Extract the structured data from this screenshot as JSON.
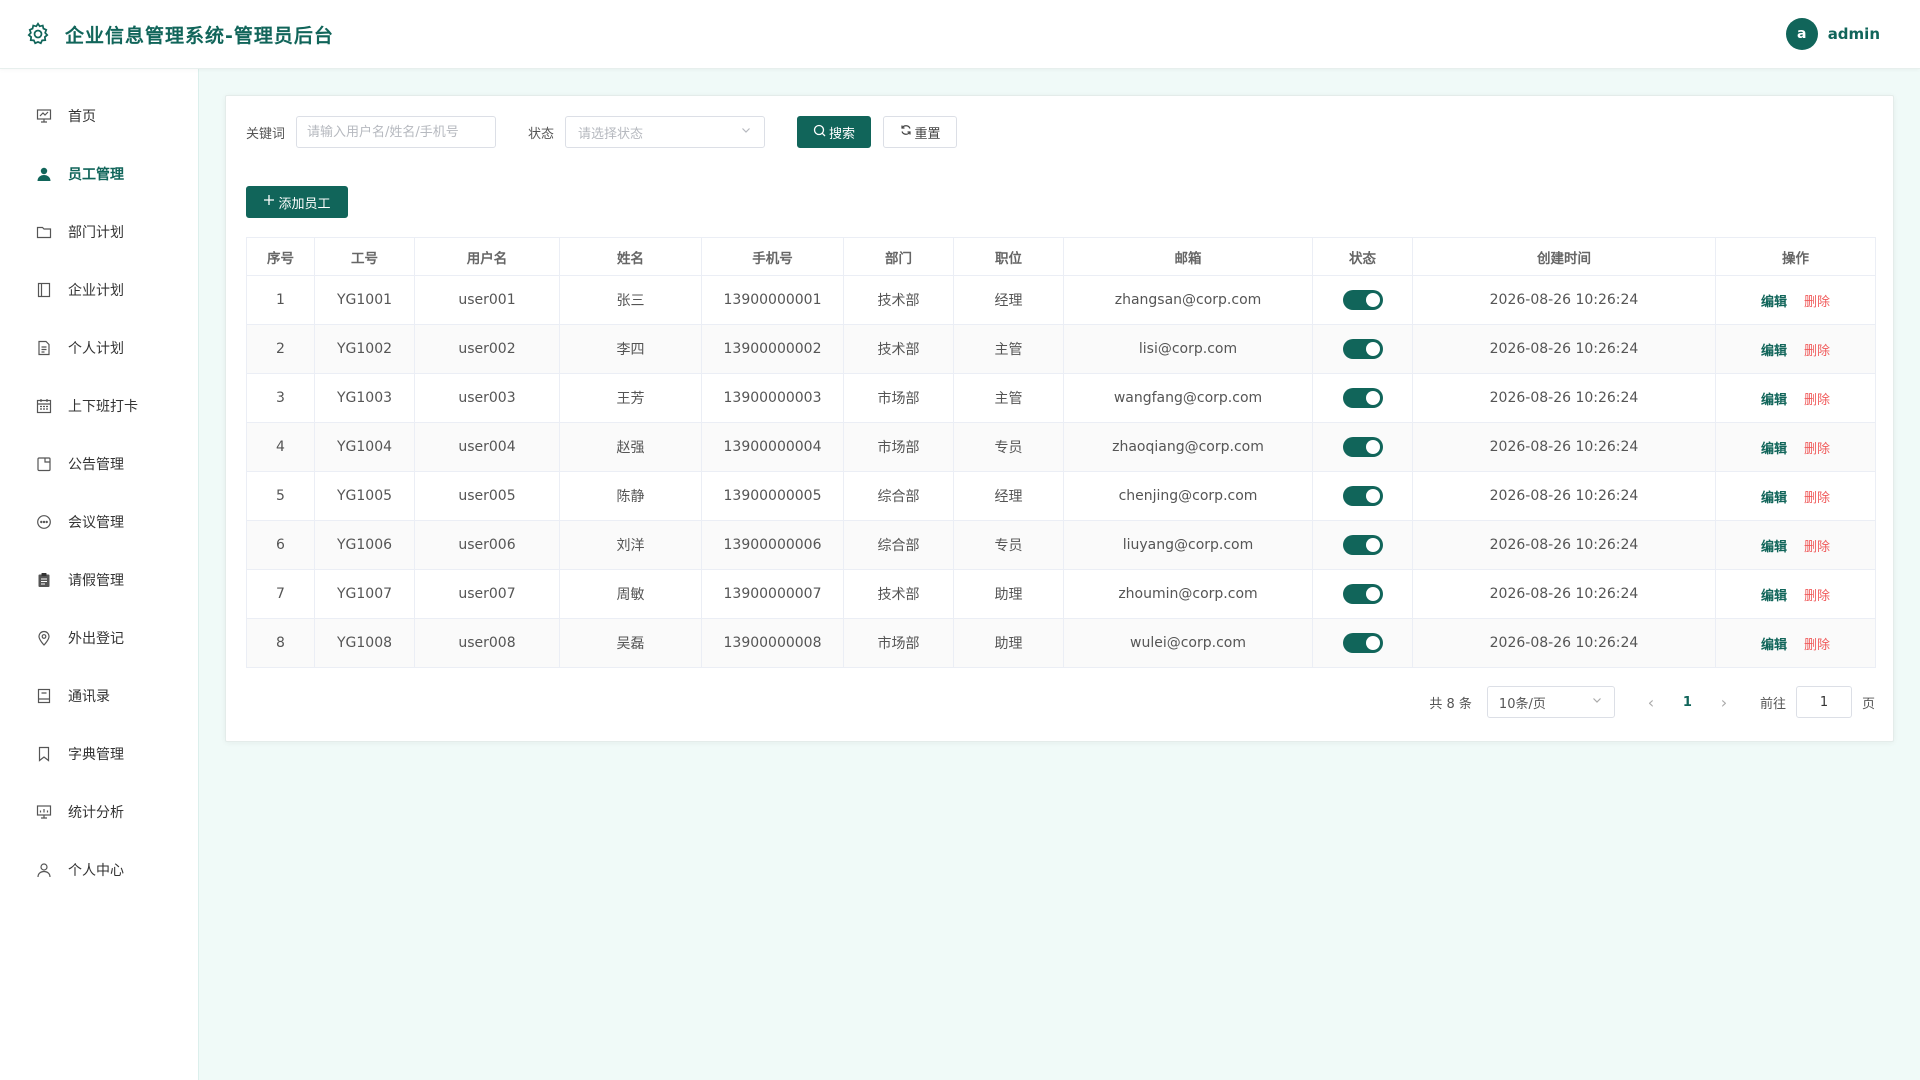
{
  "header": {
    "title": "企业信息管理系统-管理员后台",
    "avatar_letter": "a",
    "username": "admin"
  },
  "colors": {
    "accent": "#11655a",
    "danger": "#f05a5a",
    "background": "#f0faf8"
  },
  "sidebar": {
    "items": [
      {
        "label": "首页",
        "icon": "presentation-chart-icon",
        "active": false
      },
      {
        "label": "员工管理",
        "icon": "user-icon",
        "active": true
      },
      {
        "label": "部门计划",
        "icon": "folder-icon",
        "active": false
      },
      {
        "label": "企业计划",
        "icon": "notebook-icon",
        "active": false
      },
      {
        "label": "个人计划",
        "icon": "document-icon",
        "active": false
      },
      {
        "label": "上下班打卡",
        "icon": "calendar-icon",
        "active": false
      },
      {
        "label": "公告管理",
        "icon": "notice-icon",
        "active": false
      },
      {
        "label": "会议管理",
        "icon": "chat-icon",
        "active": false
      },
      {
        "label": "请假管理",
        "icon": "clipboard-icon",
        "active": false
      },
      {
        "label": "外出登记",
        "icon": "location-icon",
        "active": false
      },
      {
        "label": "通讯录",
        "icon": "contacts-book-icon",
        "active": false
      },
      {
        "label": "字典管理",
        "icon": "bookmark-icon",
        "active": false
      },
      {
        "label": "统计分析",
        "icon": "stats-board-icon",
        "active": false
      },
      {
        "label": "个人中心",
        "icon": "person-outline-icon",
        "active": false
      }
    ]
  },
  "filter": {
    "keyword_label": "关键词",
    "keyword_placeholder": "请输入用户名/姓名/手机号",
    "keyword_value": "",
    "status_label": "状态",
    "status_placeholder": "请选择状态",
    "search_label": "搜索",
    "reset_label": "重置"
  },
  "toolbar": {
    "add_label": "添加员工"
  },
  "table": {
    "columns": [
      "序号",
      "工号",
      "用户名",
      "姓名",
      "手机号",
      "部门",
      "职位",
      "邮箱",
      "状态",
      "创建时间",
      "操作"
    ],
    "edit_label": "编辑",
    "delete_label": "删除",
    "rows": [
      {
        "index": "1",
        "emp_no": "YG1001",
        "username": "user001",
        "name": "张三",
        "phone": "13900000001",
        "dept": "技术部",
        "position": "经理",
        "email": "zhangsan@corp.com",
        "enabled": true,
        "created": "2026-08-26 10:26:24"
      },
      {
        "index": "2",
        "emp_no": "YG1002",
        "username": "user002",
        "name": "李四",
        "phone": "13900000002",
        "dept": "技术部",
        "position": "主管",
        "email": "lisi@corp.com",
        "enabled": true,
        "created": "2026-08-26 10:26:24"
      },
      {
        "index": "3",
        "emp_no": "YG1003",
        "username": "user003",
        "name": "王芳",
        "phone": "13900000003",
        "dept": "市场部",
        "position": "主管",
        "email": "wangfang@corp.com",
        "enabled": true,
        "created": "2026-08-26 10:26:24"
      },
      {
        "index": "4",
        "emp_no": "YG1004",
        "username": "user004",
        "name": "赵强",
        "phone": "13900000004",
        "dept": "市场部",
        "position": "专员",
        "email": "zhaoqiang@corp.com",
        "enabled": true,
        "created": "2026-08-26 10:26:24"
      },
      {
        "index": "5",
        "emp_no": "YG1005",
        "username": "user005",
        "name": "陈静",
        "phone": "13900000005",
        "dept": "综合部",
        "position": "经理",
        "email": "chenjing@corp.com",
        "enabled": true,
        "created": "2026-08-26 10:26:24"
      },
      {
        "index": "6",
        "emp_no": "YG1006",
        "username": "user006",
        "name": "刘洋",
        "phone": "13900000006",
        "dept": "综合部",
        "position": "专员",
        "email": "liuyang@corp.com",
        "enabled": true,
        "created": "2026-08-26 10:26:24"
      },
      {
        "index": "7",
        "emp_no": "YG1007",
        "username": "user007",
        "name": "周敏",
        "phone": "13900000007",
        "dept": "技术部",
        "position": "助理",
        "email": "zhoumin@corp.com",
        "enabled": true,
        "created": "2026-08-26 10:26:24"
      },
      {
        "index": "8",
        "emp_no": "YG1008",
        "username": "user008",
        "name": "吴磊",
        "phone": "13900000008",
        "dept": "市场部",
        "position": "助理",
        "email": "wulei@corp.com",
        "enabled": true,
        "created": "2026-08-26 10:26:24"
      }
    ]
  },
  "pagination": {
    "total_text": "共 8 条",
    "page_size": "10条/页",
    "current_page": "1",
    "goto_label": "前往",
    "goto_value": "1",
    "page_suffix": "页"
  }
}
